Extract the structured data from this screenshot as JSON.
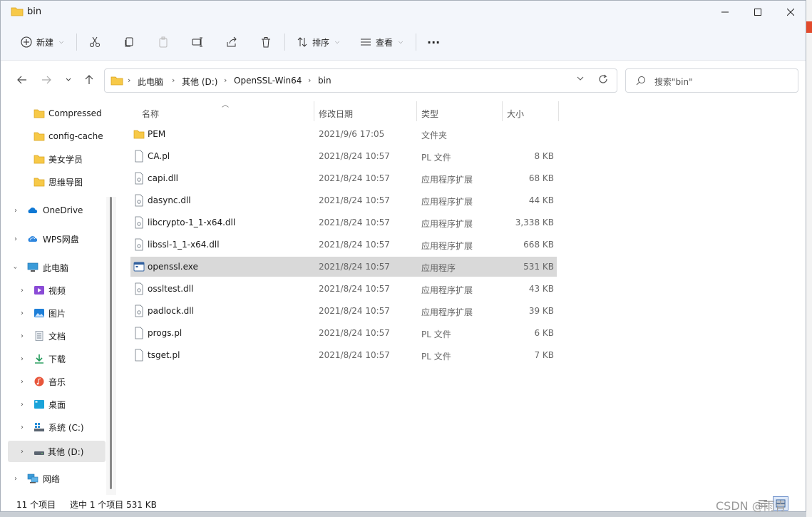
{
  "window": {
    "title": "bin"
  },
  "toolbar": {
    "new_label": "新建",
    "sort_label": "排序",
    "view_label": "查看",
    "more_label": "···"
  },
  "address": {
    "crumbs": [
      "此电脑",
      "其他 (D:)",
      "OpenSSL-Win64",
      "bin"
    ]
  },
  "search": {
    "placeholder": "搜索\"bin\""
  },
  "sidebar": {
    "items": [
      {
        "label": "Compressed",
        "icon": "folder-icon"
      },
      {
        "label": "config-cache",
        "icon": "folder-icon"
      },
      {
        "label": "美女学员",
        "icon": "folder-icon"
      },
      {
        "label": "思维导图",
        "icon": "folder-icon"
      },
      {
        "label": "OneDrive",
        "icon": "onedrive-icon"
      },
      {
        "label": "WPS网盘",
        "icon": "wps-cloud-icon"
      },
      {
        "label": "此电脑",
        "icon": "computer-icon"
      },
      {
        "label": "视频",
        "icon": "video-icon"
      },
      {
        "label": "图片",
        "icon": "picture-icon"
      },
      {
        "label": "文档",
        "icon": "document-icon"
      },
      {
        "label": "下载",
        "icon": "download-icon"
      },
      {
        "label": "音乐",
        "icon": "music-icon"
      },
      {
        "label": "桌面",
        "icon": "desktop-icon"
      },
      {
        "label": "系统 (C:)",
        "icon": "drive-icon"
      },
      {
        "label": "其他 (D:)",
        "icon": "drive-icon"
      },
      {
        "label": "网络",
        "icon": "network-icon"
      }
    ]
  },
  "columns": {
    "name": "名称",
    "date": "修改日期",
    "type": "类型",
    "size": "大小"
  },
  "files": [
    {
      "name": "PEM",
      "date": "2021/9/6 17:05",
      "type": "文件夹",
      "size": "",
      "icon": "folder-icon"
    },
    {
      "name": "CA.pl",
      "date": "2021/8/24 10:57",
      "type": "PL 文件",
      "size": "8 KB",
      "icon": "file-icon"
    },
    {
      "name": "capi.dll",
      "date": "2021/8/24 10:57",
      "type": "应用程序扩展",
      "size": "68 KB",
      "icon": "dll-icon"
    },
    {
      "name": "dasync.dll",
      "date": "2021/8/24 10:57",
      "type": "应用程序扩展",
      "size": "44 KB",
      "icon": "dll-icon"
    },
    {
      "name": "libcrypto-1_1-x64.dll",
      "date": "2021/8/24 10:57",
      "type": "应用程序扩展",
      "size": "3,338 KB",
      "icon": "dll-icon"
    },
    {
      "name": "libssl-1_1-x64.dll",
      "date": "2021/8/24 10:57",
      "type": "应用程序扩展",
      "size": "668 KB",
      "icon": "dll-icon"
    },
    {
      "name": "openssl.exe",
      "date": "2021/8/24 10:57",
      "type": "应用程序",
      "size": "531 KB",
      "icon": "exe-icon"
    },
    {
      "name": "ossltest.dll",
      "date": "2021/8/24 10:57",
      "type": "应用程序扩展",
      "size": "43 KB",
      "icon": "dll-icon"
    },
    {
      "name": "padlock.dll",
      "date": "2021/8/24 10:57",
      "type": "应用程序扩展",
      "size": "39 KB",
      "icon": "dll-icon"
    },
    {
      "name": "progs.pl",
      "date": "2021/8/24 10:57",
      "type": "PL 文件",
      "size": "6 KB",
      "icon": "file-icon"
    },
    {
      "name": "tsget.pl",
      "date": "2021/8/24 10:57",
      "type": "PL 文件",
      "size": "7 KB",
      "icon": "file-icon"
    }
  ],
  "status": {
    "count": "11 个项目",
    "selection": "选中 1 个项目 531 KB"
  },
  "watermark": "CSDN @雨青",
  "colors": {
    "selection": "#d9d9d9",
    "folder": "#f7c948",
    "accent": "#0067c0"
  }
}
